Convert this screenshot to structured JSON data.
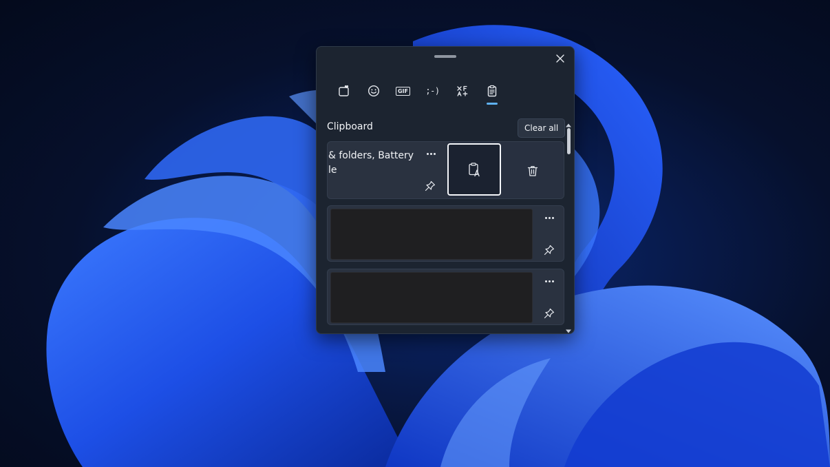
{
  "panel": {
    "tabs": [
      {
        "icon": "emoji-sticker-icon"
      },
      {
        "icon": "smiley-icon"
      },
      {
        "icon": "gif-icon",
        "label": "GIF"
      },
      {
        "icon": "kaomoji-icon",
        "label": ";-)"
      },
      {
        "icon": "symbols-icon"
      },
      {
        "icon": "clipboard-icon",
        "active": true
      }
    ],
    "section_title": "Clipboard",
    "clear_all_label": "Clear all",
    "items": [
      {
        "text": "& folders, Battery\nle",
        "actions": [
          "paste-as-plain-text-icon",
          "trash-icon"
        ]
      },
      {
        "type": "image"
      },
      {
        "type": "image"
      }
    ]
  },
  "colors": {
    "panel_bg": "#1c2430",
    "item_bg": "#2a3240",
    "accent_underline": "#5fb2f2",
    "wallpaper_blue": "#1f4fe0"
  }
}
